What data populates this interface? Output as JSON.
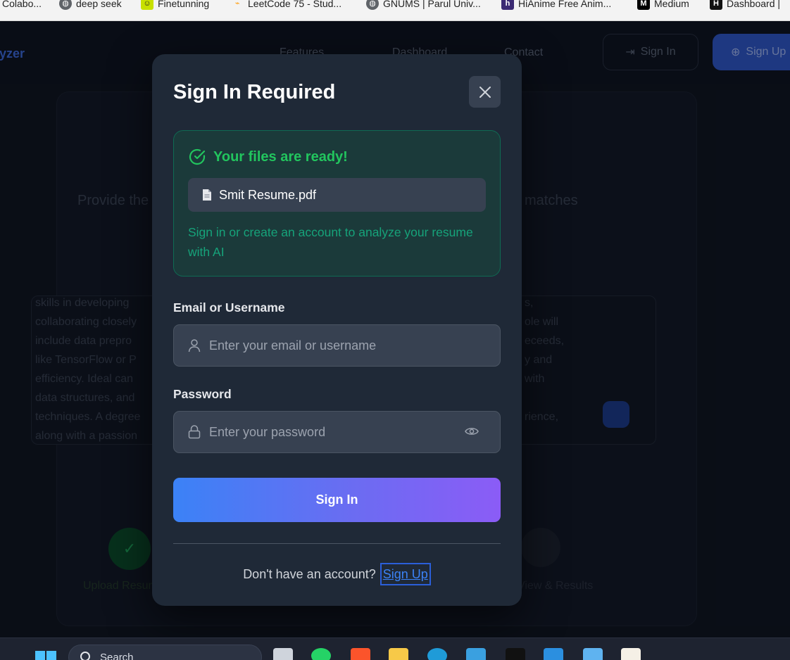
{
  "bookmarks": [
    {
      "label": "Colabo...",
      "icon": "colab-icon",
      "color": "#f9ab00"
    },
    {
      "label": "deep seek",
      "icon": "globe-icon",
      "color": "#5f6368"
    },
    {
      "label": "Finetunning",
      "icon": "smiley-icon",
      "color": "#c8e000"
    },
    {
      "label": "LeetCode 75 - Stud...",
      "icon": "leetcode-icon",
      "color": "#ffa116"
    },
    {
      "label": "GNUMS | Parul Univ...",
      "icon": "globe-icon",
      "color": "#5f6368"
    },
    {
      "label": "HiAnime Free Anim...",
      "icon": "hianime-icon",
      "color": "#3b2a73"
    },
    {
      "label": "Medium",
      "icon": "medium-icon",
      "color": "#000000"
    },
    {
      "label": "Dashboard | ",
      "icon": "hackerrank-icon",
      "color": "#111111"
    }
  ],
  "background": {
    "logo": "Analyzer",
    "nav_links": [
      "Features",
      "Dashboard",
      "Contact"
    ],
    "sign_in": "Sign In",
    "sign_up": "Sign Up",
    "subtitle_left": "Provide the",
    "subtitle_right": "matches",
    "text_lines_left": [
      "skills in developing",
      "collaborating closely",
      "include data prepro",
      "like TensorFlow or P",
      "efficiency. Ideal can",
      "data structures, and",
      "techniques. A degree",
      "along with a passion"
    ],
    "text_lines_right": [
      "s,",
      "ole will",
      "eceeds,",
      "y and",
      "with",
      "",
      "rience,",
      ""
    ],
    "step_label_left": "Upload Resume",
    "step_label_right": "View & Results"
  },
  "modal": {
    "title": "Sign In Required",
    "ready": {
      "title": "Your files are ready!",
      "file_name": "Smit Resume.pdf",
      "message": "Sign in or create an account to analyze your resume with AI"
    },
    "email": {
      "label": "Email or Username",
      "placeholder": "Enter your email or username",
      "value": ""
    },
    "password": {
      "label": "Password",
      "placeholder": "Enter your password",
      "value": ""
    },
    "submit_label": "Sign In",
    "footer_text": "Don't have an account?",
    "signup_label": "Sign Up"
  },
  "taskbar": {
    "search_placeholder": "Search"
  },
  "colors": {
    "modal_bg": "#1f2937",
    "accent_green": "#22c55e",
    "gradient_start": "#3b82f6",
    "gradient_end": "#8b5cf6"
  }
}
